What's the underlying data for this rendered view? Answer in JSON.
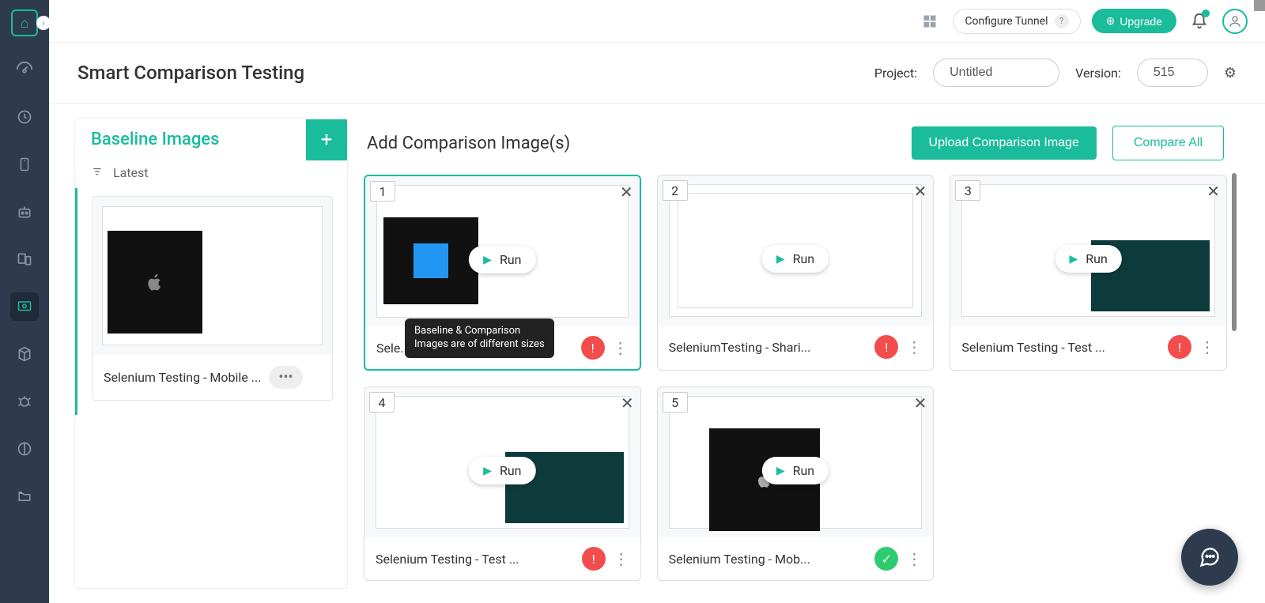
{
  "topbar": {
    "configure_label": "Configure Tunnel",
    "upgrade_label": "Upgrade"
  },
  "header": {
    "title": "Smart Comparison Testing",
    "project_label": "Project:",
    "project_value": "Untitled",
    "version_label": "Version:",
    "version_value": "515"
  },
  "baseline": {
    "heading": "Baseline Images",
    "filter_label": "Latest",
    "card_title": "Selenium Testing - Mobile ..."
  },
  "comparison": {
    "heading": "Add Comparison Image(s)",
    "upload_label": "Upload Comparison Image",
    "compare_all_label": "Compare All",
    "run_label": "Run",
    "tooltip_line1": "Baseline & Comparison",
    "tooltip_line2": "Images are of different sizes",
    "cards": [
      {
        "num": "1",
        "title": "Sele...",
        "status": "error",
        "thumb": "blue"
      },
      {
        "num": "2",
        "title": "SeleniumTesting - Shari...",
        "status": "error",
        "thumb": "table"
      },
      {
        "num": "3",
        "title": "Selenium Testing - Test ...",
        "status": "error",
        "thumb": "green"
      },
      {
        "num": "4",
        "title": "Selenium Testing - Test ...",
        "status": "error",
        "thumb": "green"
      },
      {
        "num": "5",
        "title": "Selenium Testing - Mob...",
        "status": "ok",
        "thumb": "apple"
      }
    ]
  }
}
